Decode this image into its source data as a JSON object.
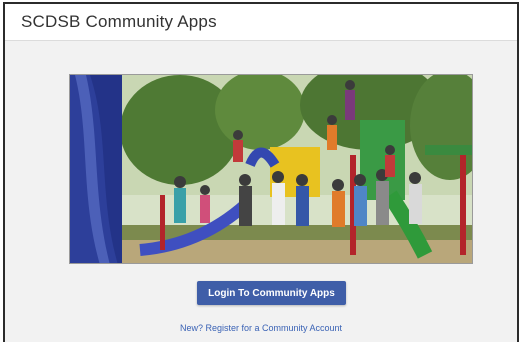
{
  "header": {
    "title": "SCDSB Community Apps"
  },
  "hero": {
    "image_semantic": "community-group-playground-photo"
  },
  "actions": {
    "login_label": "Login To Community Apps",
    "register_label": "New? Register for a Community Account"
  },
  "colors": {
    "button_bg": "#3f5ea8",
    "link": "#3b63b5",
    "content_bg": "#f2f2f2"
  }
}
